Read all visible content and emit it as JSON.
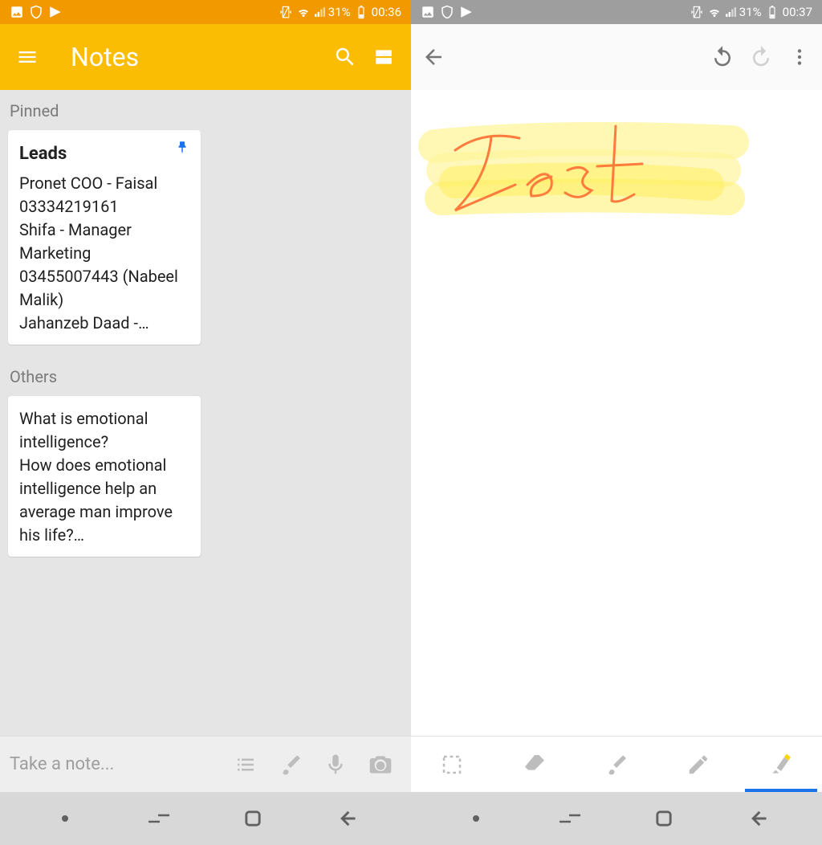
{
  "left": {
    "status": {
      "battery": "31%",
      "time": "00:36"
    },
    "header_title": "Notes",
    "sections": {
      "pinned_label": "Pinned",
      "others_label": "Others"
    },
    "notes": {
      "pinned": {
        "title": "Leads",
        "body": "Pronet COO - Faisal 03334219161\nShifa - Manager Marketing 03455007443 (Nabeel Malik)\nJahanzeb Daad -…"
      },
      "other": {
        "body": "What is emotional intelligence?\nHow does emotional intelligence help an average man improve his life?…"
      }
    },
    "new_note_placeholder": "Take a note..."
  },
  "right": {
    "status": {
      "battery": "31%",
      "time": "00:37"
    },
    "drawing_text": "Test"
  }
}
